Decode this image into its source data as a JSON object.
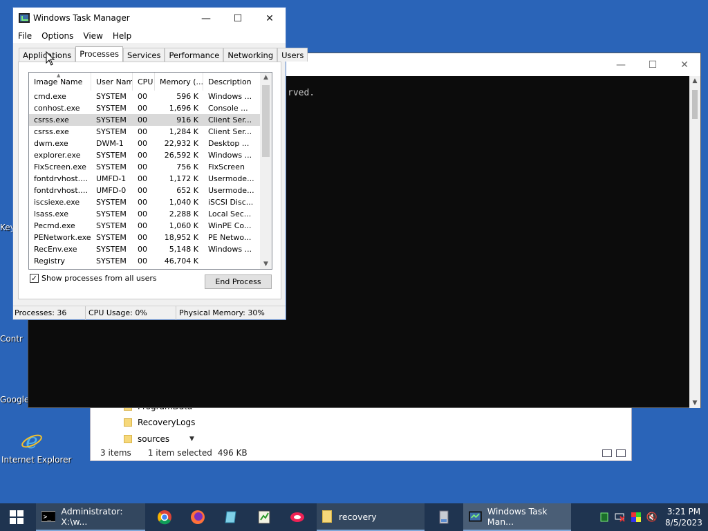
{
  "desktop": {
    "icons": [
      {
        "label": "Key"
      },
      {
        "label": "Contr"
      },
      {
        "label": "Google"
      },
      {
        "label": "Internet Explorer"
      }
    ]
  },
  "explorer": {
    "folders": [
      "ProgramData",
      "RecoveryLogs",
      "sources"
    ],
    "status": {
      "items": "3 items",
      "selected": "1 item selected",
      "size": "496 KB"
    }
  },
  "console": {
    "text": "rved."
  },
  "taskmanager": {
    "title": "Windows Task Manager",
    "menu": [
      "File",
      "Options",
      "View",
      "Help"
    ],
    "tabs": [
      "Applications",
      "Processes",
      "Services",
      "Performance",
      "Networking",
      "Users"
    ],
    "active_tab": "Processes",
    "columns": [
      "Image Name",
      "User Name",
      "CPU",
      "Memory (...",
      "Description"
    ],
    "processes": [
      {
        "name": "cmd.exe",
        "user": "SYSTEM",
        "cpu": "00",
        "mem": "596 K",
        "desc": "Windows ..."
      },
      {
        "name": "conhost.exe",
        "user": "SYSTEM",
        "cpu": "00",
        "mem": "1,696 K",
        "desc": "Console ..."
      },
      {
        "name": "csrss.exe",
        "user": "SYSTEM",
        "cpu": "00",
        "mem": "916 K",
        "desc": "Client Ser..."
      },
      {
        "name": "csrss.exe",
        "user": "SYSTEM",
        "cpu": "00",
        "mem": "1,284 K",
        "desc": "Client Ser..."
      },
      {
        "name": "dwm.exe",
        "user": "DWM-1",
        "cpu": "00",
        "mem": "22,932 K",
        "desc": "Desktop ..."
      },
      {
        "name": "explorer.exe",
        "user": "SYSTEM",
        "cpu": "00",
        "mem": "26,592 K",
        "desc": "Windows ..."
      },
      {
        "name": "FixScreen.exe",
        "user": "SYSTEM",
        "cpu": "00",
        "mem": "756 K",
        "desc": "FixScreen"
      },
      {
        "name": "fontdrvhost.exe",
        "user": "UMFD-1",
        "cpu": "00",
        "mem": "1,172 K",
        "desc": "Usermode..."
      },
      {
        "name": "fontdrvhost.exe",
        "user": "UMFD-0",
        "cpu": "00",
        "mem": "652 K",
        "desc": "Usermode..."
      },
      {
        "name": "iscsiexe.exe",
        "user": "SYSTEM",
        "cpu": "00",
        "mem": "1,040 K",
        "desc": "iSCSI Disc..."
      },
      {
        "name": "lsass.exe",
        "user": "SYSTEM",
        "cpu": "00",
        "mem": "2,288 K",
        "desc": "Local Sec..."
      },
      {
        "name": "Pecmd.exe",
        "user": "SYSTEM",
        "cpu": "00",
        "mem": "1,060 K",
        "desc": "WinPE Co..."
      },
      {
        "name": "PENetwork.exe",
        "user": "SYSTEM",
        "cpu": "00",
        "mem": "18,952 K",
        "desc": "PE Netwo..."
      },
      {
        "name": "RecEnv.exe",
        "user": "SYSTEM",
        "cpu": "00",
        "mem": "5,148 K",
        "desc": "Windows ..."
      },
      {
        "name": "Registry",
        "user": "SYSTEM",
        "cpu": "00",
        "mem": "46,704 K",
        "desc": ""
      }
    ],
    "selected_index": 2,
    "show_all_label": "Show processes from all users",
    "show_all_checked": true,
    "end_process_label": "End Process",
    "status": {
      "processes": "Processes: 36",
      "cpu": "CPU Usage: 0%",
      "memory": "Physical Memory: 30%"
    }
  },
  "taskbar": {
    "items": [
      {
        "label": "Administrator: X:\\w...",
        "icon": "console-icon"
      },
      {
        "label": "recovery",
        "icon": "folder-icon"
      },
      {
        "label": "Windows Task Man...",
        "icon": "task-manager-icon"
      }
    ],
    "clock": {
      "time": "3:21 PM",
      "date": "8/5/2023"
    }
  }
}
